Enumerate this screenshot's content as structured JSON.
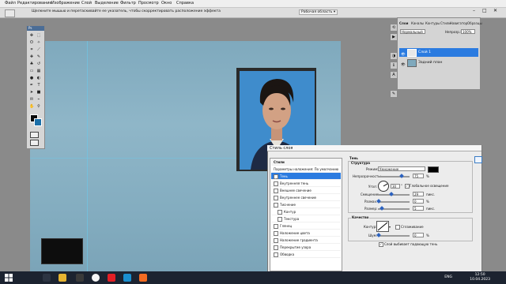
{
  "menubar": {
    "items": [
      "Файл",
      "Редактирование",
      "Изображение",
      "Слой",
      "Выделение",
      "Фильтр",
      "Просмотр",
      "Окно",
      "Справка"
    ],
    "hint": "Щелкните мышью и перетаскивайте ее указатель, чтобы скорректировать расположение эффекта",
    "workspace": "Рабочая область ▾"
  },
  "toolbox": {
    "title": "Ps"
  },
  "panels": {
    "tabs": [
      "Слои",
      "Каналы",
      "Контуры",
      "Стили",
      "Навигатор",
      "Образцы"
    ],
    "blend_mode": "Нормальный",
    "opacity_label": "Непрозр.:",
    "opacity_value": "100%",
    "layers": [
      {
        "name": "Слой 1",
        "selected": true
      },
      {
        "name": "Задний план",
        "selected": false
      }
    ]
  },
  "dialog": {
    "title": "Стиль слоя",
    "styles_header": "Стили",
    "style_items": [
      {
        "label": "Параметры наложения: По умолчанию",
        "checkbox": false,
        "selected": false
      },
      {
        "label": "Тень",
        "checkbox": true,
        "checked": true,
        "selected": true
      },
      {
        "label": "Внутренняя тень",
        "checkbox": true,
        "checked": false
      },
      {
        "label": "Внешнее свечение",
        "checkbox": true,
        "checked": false
      },
      {
        "label": "Внутреннее свечение",
        "checkbox": true,
        "checked": false
      },
      {
        "label": "Тиснение",
        "checkbox": true,
        "checked": false
      },
      {
        "label": "Контур",
        "checkbox": true,
        "checked": false,
        "indent": true
      },
      {
        "label": "Текстура",
        "checkbox": true,
        "checked": false,
        "indent": true
      },
      {
        "label": "Глянец",
        "checkbox": true,
        "checked": false
      },
      {
        "label": "Наложение цвета",
        "checkbox": true,
        "checked": false
      },
      {
        "label": "Наложение градиента",
        "checkbox": true,
        "checked": false
      },
      {
        "label": "Перекрытие узора",
        "checkbox": true,
        "checked": false
      },
      {
        "label": "Обводка",
        "checkbox": true,
        "checked": false
      }
    ],
    "shadow": {
      "section_title": "Тень",
      "structure_title": "Структура",
      "mode_label": "Режим:",
      "mode_value": "Умножение",
      "opacity_label": "Непрозрачность:",
      "opacity_value": "75",
      "opacity_fraction": 0.75,
      "angle_label": "Угол:",
      "angle_value": "30",
      "global_light_label": "Глобальное освещение",
      "distance_label": "Смещение:",
      "distance_value": "29",
      "spread_label": "Размах:",
      "spread_value": "0",
      "size_label": "Размер:",
      "size_value": "5",
      "unit_px": "пикс.",
      "unit_pct": "%",
      "degree": "°",
      "quality_title": "Качество",
      "contour_label": "Контур:",
      "antialias_label": "Сглаживание",
      "noise_label": "Шум:",
      "noise_value": "0",
      "knockout_label": "Слой выбивает падающую тень",
      "shadow_color": "#000000"
    }
  },
  "taskbar": {
    "lang": "ENG",
    "time": "12:50",
    "date": "10.04.2023"
  },
  "colors": {
    "canvas": "#86afc2",
    "accent": "#2b62c0",
    "selected_row": "#2b7be0",
    "taskbar": "#1c2330"
  }
}
